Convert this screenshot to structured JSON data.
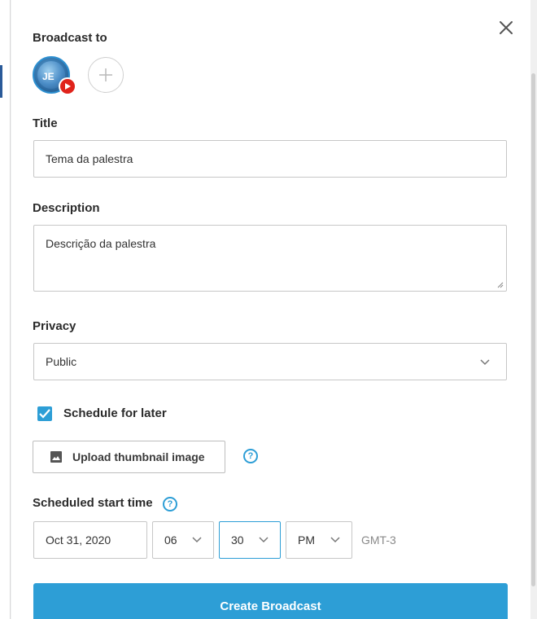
{
  "broadcast_to": {
    "label": "Broadcast to",
    "destination_avatar_text": "JE",
    "platform_badge_icon": "youtube-icon",
    "add_icon": "plus-icon"
  },
  "title": {
    "label": "Title",
    "value": "Tema da palestra"
  },
  "description": {
    "label": "Description",
    "value": "Descrição da palestra"
  },
  "privacy": {
    "label": "Privacy",
    "value": "Public"
  },
  "schedule": {
    "checkbox_label": "Schedule for later",
    "checked": true
  },
  "thumbnail": {
    "button_label": "Upload thumbnail image",
    "icon": "image-icon",
    "help_icon": "?"
  },
  "start_time": {
    "label": "Scheduled start time",
    "help_icon": "?",
    "date": "Oct 31, 2020",
    "hour": "06",
    "minute": "30",
    "ampm": "PM",
    "timezone": "GMT-3"
  },
  "actions": {
    "create_label": "Create Broadcast"
  },
  "colors": {
    "accent": "#2d9ed6",
    "youtube": "#e0231b"
  }
}
